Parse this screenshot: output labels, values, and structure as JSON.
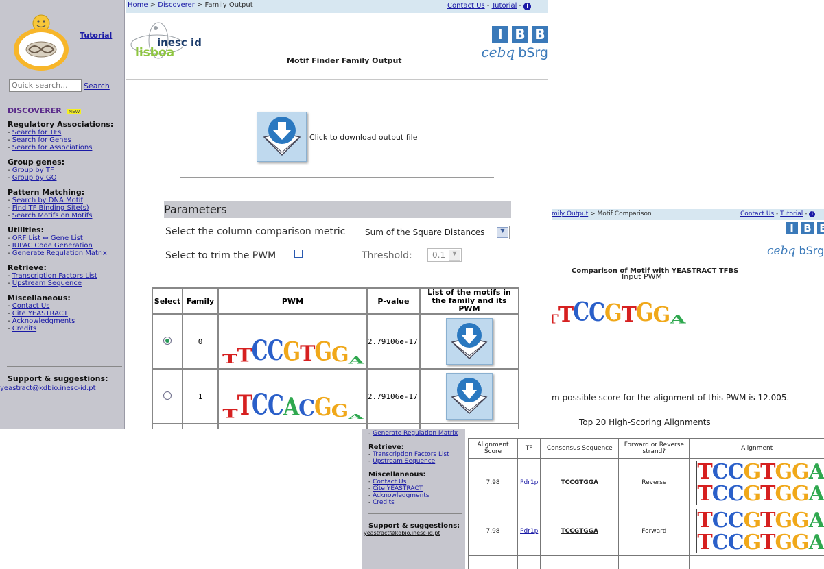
{
  "sidebar": {
    "tutorial": "Tutorial",
    "search_placeholder": "Quick search...",
    "search_button": "Search",
    "discoverer": "DISCOVERER",
    "new_badge": "NEW",
    "sections": [
      {
        "title": "Regulatory Associations:",
        "items": [
          "Search for TFs",
          "Search for Genes",
          "Search for Associations"
        ]
      },
      {
        "title": "Group genes:",
        "items": [
          "Group by TF",
          "Group by GO"
        ]
      },
      {
        "title": "Pattern Matching:",
        "items": [
          "Search by DNA Motif",
          "Find TF Binding Site(s)",
          "Search Motifs on Motifs"
        ]
      },
      {
        "title": "Utilities:",
        "items": [
          "ORF List ⇔ Gene List",
          "IUPAC Code Generation",
          "Generate Regulation Matrix"
        ]
      },
      {
        "title": "Retrieve:",
        "items": [
          "Transcription Factors List",
          "Upstream Sequence"
        ]
      },
      {
        "title": "Miscellaneous:",
        "items": [
          "Contact Us",
          "Cite YEASTRACT",
          "Acknowledgments",
          "Credits"
        ]
      }
    ],
    "support_title": "Support & suggestions:",
    "support_email": "yeastract@kdbio.inesc-id.pt"
  },
  "header": {
    "crumb_home": "Home",
    "crumb_sep": " > ",
    "crumb_discoverer": "Discoverer",
    "crumb_current": " > Family Output",
    "contact": "Contact Us",
    "tutorial": "Tutorial",
    "page_title": "Motif Finder Family Output",
    "inesc": "inesc id",
    "lisboa": "lisboa",
    "ibb": [
      "I",
      "B",
      "B"
    ],
    "cebg": "cebq",
    "bsrg": "bSrg"
  },
  "download": {
    "label": "Click to download output file"
  },
  "params": {
    "title": "Parameters",
    "metric_label": "Select the column comparison metric",
    "metric_value": "Sum of the Square Distances",
    "trim_label": "Select to trim the PWM",
    "threshold_label": "Threshold:",
    "threshold_value": "0.1"
  },
  "table": {
    "headers": [
      "Select",
      "Family",
      "PWM",
      "P-value",
      "List of the motifs in the family and its PWM"
    ],
    "rows": [
      {
        "family": "0",
        "pvalue": "2.79106e-17",
        "selected": true,
        "motif": "TTCCGTGGA"
      },
      {
        "family": "1",
        "pvalue": "2.79106e-17",
        "selected": false,
        "motif": "TTCCACGGA"
      }
    ]
  },
  "comparison": {
    "crumb_part": "mily Output",
    "crumb_current": " > Motif Comparison",
    "contact": "Contact Us",
    "tutorial": "Tutorial",
    "title": "Comparison of Motif with YEASTRACT TFBS",
    "input_pwm": "Input PWM",
    "input_motif": "TTCCGTGGA",
    "score_text": "m possible score for the alignment of this PWM is 12.005.",
    "top20": "Top 20 High-Scoring Alignments"
  },
  "alignments": {
    "headers": [
      "Alignment Score",
      "TF",
      "Consensus Sequence",
      "Forward or Reverse strand?",
      "Alignment"
    ],
    "rows": [
      {
        "score": "7.98",
        "tf": "Pdr1p",
        "consensus": "TCCGTGGA",
        "strand": "Reverse"
      },
      {
        "score": "7.98",
        "tf": "Pdr1p",
        "consensus": "TCCGTGGA",
        "strand": "Forward"
      }
    ]
  },
  "colors": {
    "A": "#2fa84f",
    "C": "#2a5fc9",
    "G": "#f0a81a",
    "T": "#d62020"
  }
}
